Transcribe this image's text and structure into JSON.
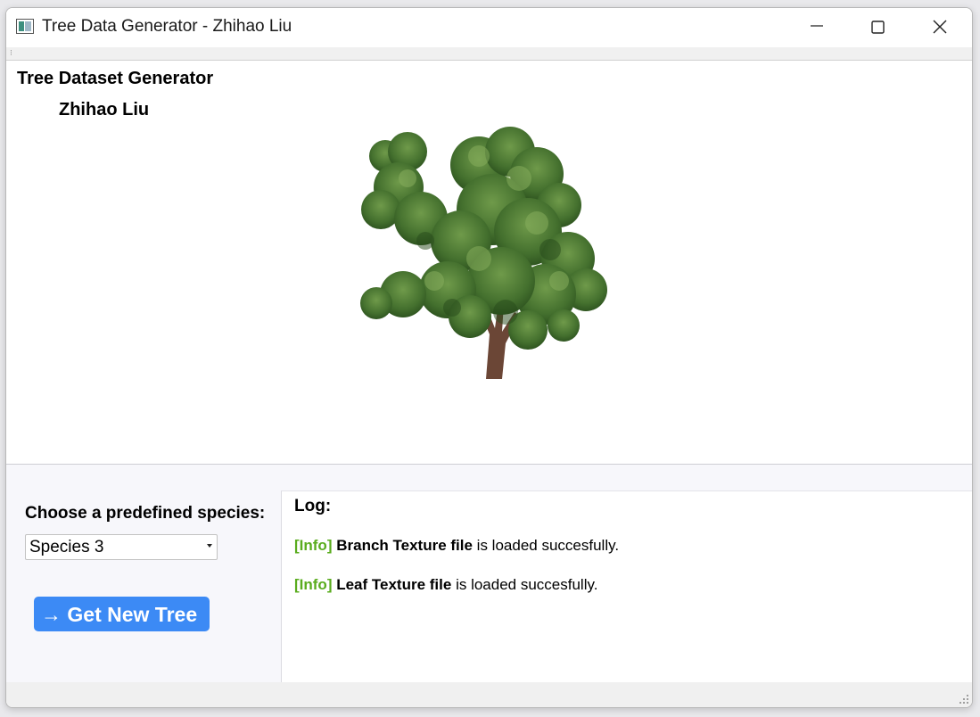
{
  "window": {
    "title": "Tree Data Generator - Zhihao Liu",
    "controls": [
      "minimize-icon",
      "maximize-icon",
      "close-icon"
    ]
  },
  "header": {
    "title": "Tree Dataset Generator",
    "author": "Zhihao Liu"
  },
  "controls": {
    "species_label": "Choose a predefined species:",
    "species_selected": "Species 3",
    "button_label": "→ Get New Tree",
    "button_color": "#3c8af5"
  },
  "log": {
    "title": "Log:",
    "entries": [
      {
        "tag": "[Info]",
        "file": "Branch Texture file",
        "message": " is loaded succesfully."
      },
      {
        "tag": "[Info]",
        "file": "Leaf Texture file",
        "message": " is loaded succesfully."
      }
    ],
    "tag_color": "#5aac1e"
  }
}
